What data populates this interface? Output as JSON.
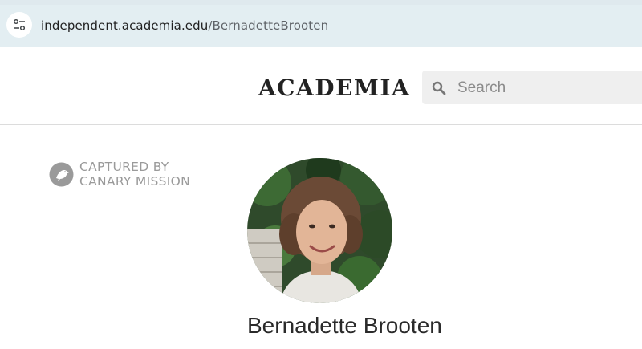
{
  "browser": {
    "url_host": "independent.academia.edu",
    "url_path": "/BernadetteBrooten",
    "site_info_icon": "tune-icon"
  },
  "header": {
    "logo": "ACADEMIA",
    "search_placeholder": "Search",
    "search_icon": "search-icon"
  },
  "watermark": {
    "line1": "CAPTURED BY",
    "line2": "CANARY MISSION",
    "icon": "canary-mission-logo"
  },
  "profile": {
    "name": "Bernadette Brooten",
    "avatar": "profile-photo"
  },
  "colors": {
    "address_bar": "#e3eef2",
    "search_bg": "#efefef",
    "watermark": "#9a9a9a"
  }
}
